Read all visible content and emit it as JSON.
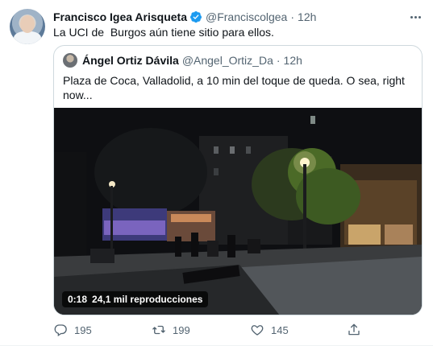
{
  "tweet": {
    "author_name": "Francisco Igea Arisqueta",
    "handle": "@Franciscolgea",
    "separator": "·",
    "time": "12h",
    "text": "La UCI de  Burgos aún tiene sitio para ellos.",
    "avatar_icon": "profile-avatar",
    "verified_icon": "verified-badge-icon",
    "more_icon": "more-options-icon"
  },
  "quote": {
    "author_name": "Ángel Ortiz Dávila",
    "handle": "@Angel_Ortiz_Da",
    "separator": "·",
    "time": "12h",
    "text": "Plaza de Coca, Valladolid, a 10 min del toque de queda. O sea, right now...",
    "video": {
      "duration": "0:18",
      "views": "24,1 mil reproducciones"
    }
  },
  "actions": {
    "reply_count": "195",
    "retweet_count": "199",
    "like_count": "145",
    "reply_icon": "reply-icon",
    "retweet_icon": "retweet-icon",
    "like_icon": "heart-icon",
    "share_icon": "share-icon"
  },
  "colors": {
    "accent": "#1d9bf0",
    "secondary_text": "#536471",
    "border": "#cfd9de"
  }
}
